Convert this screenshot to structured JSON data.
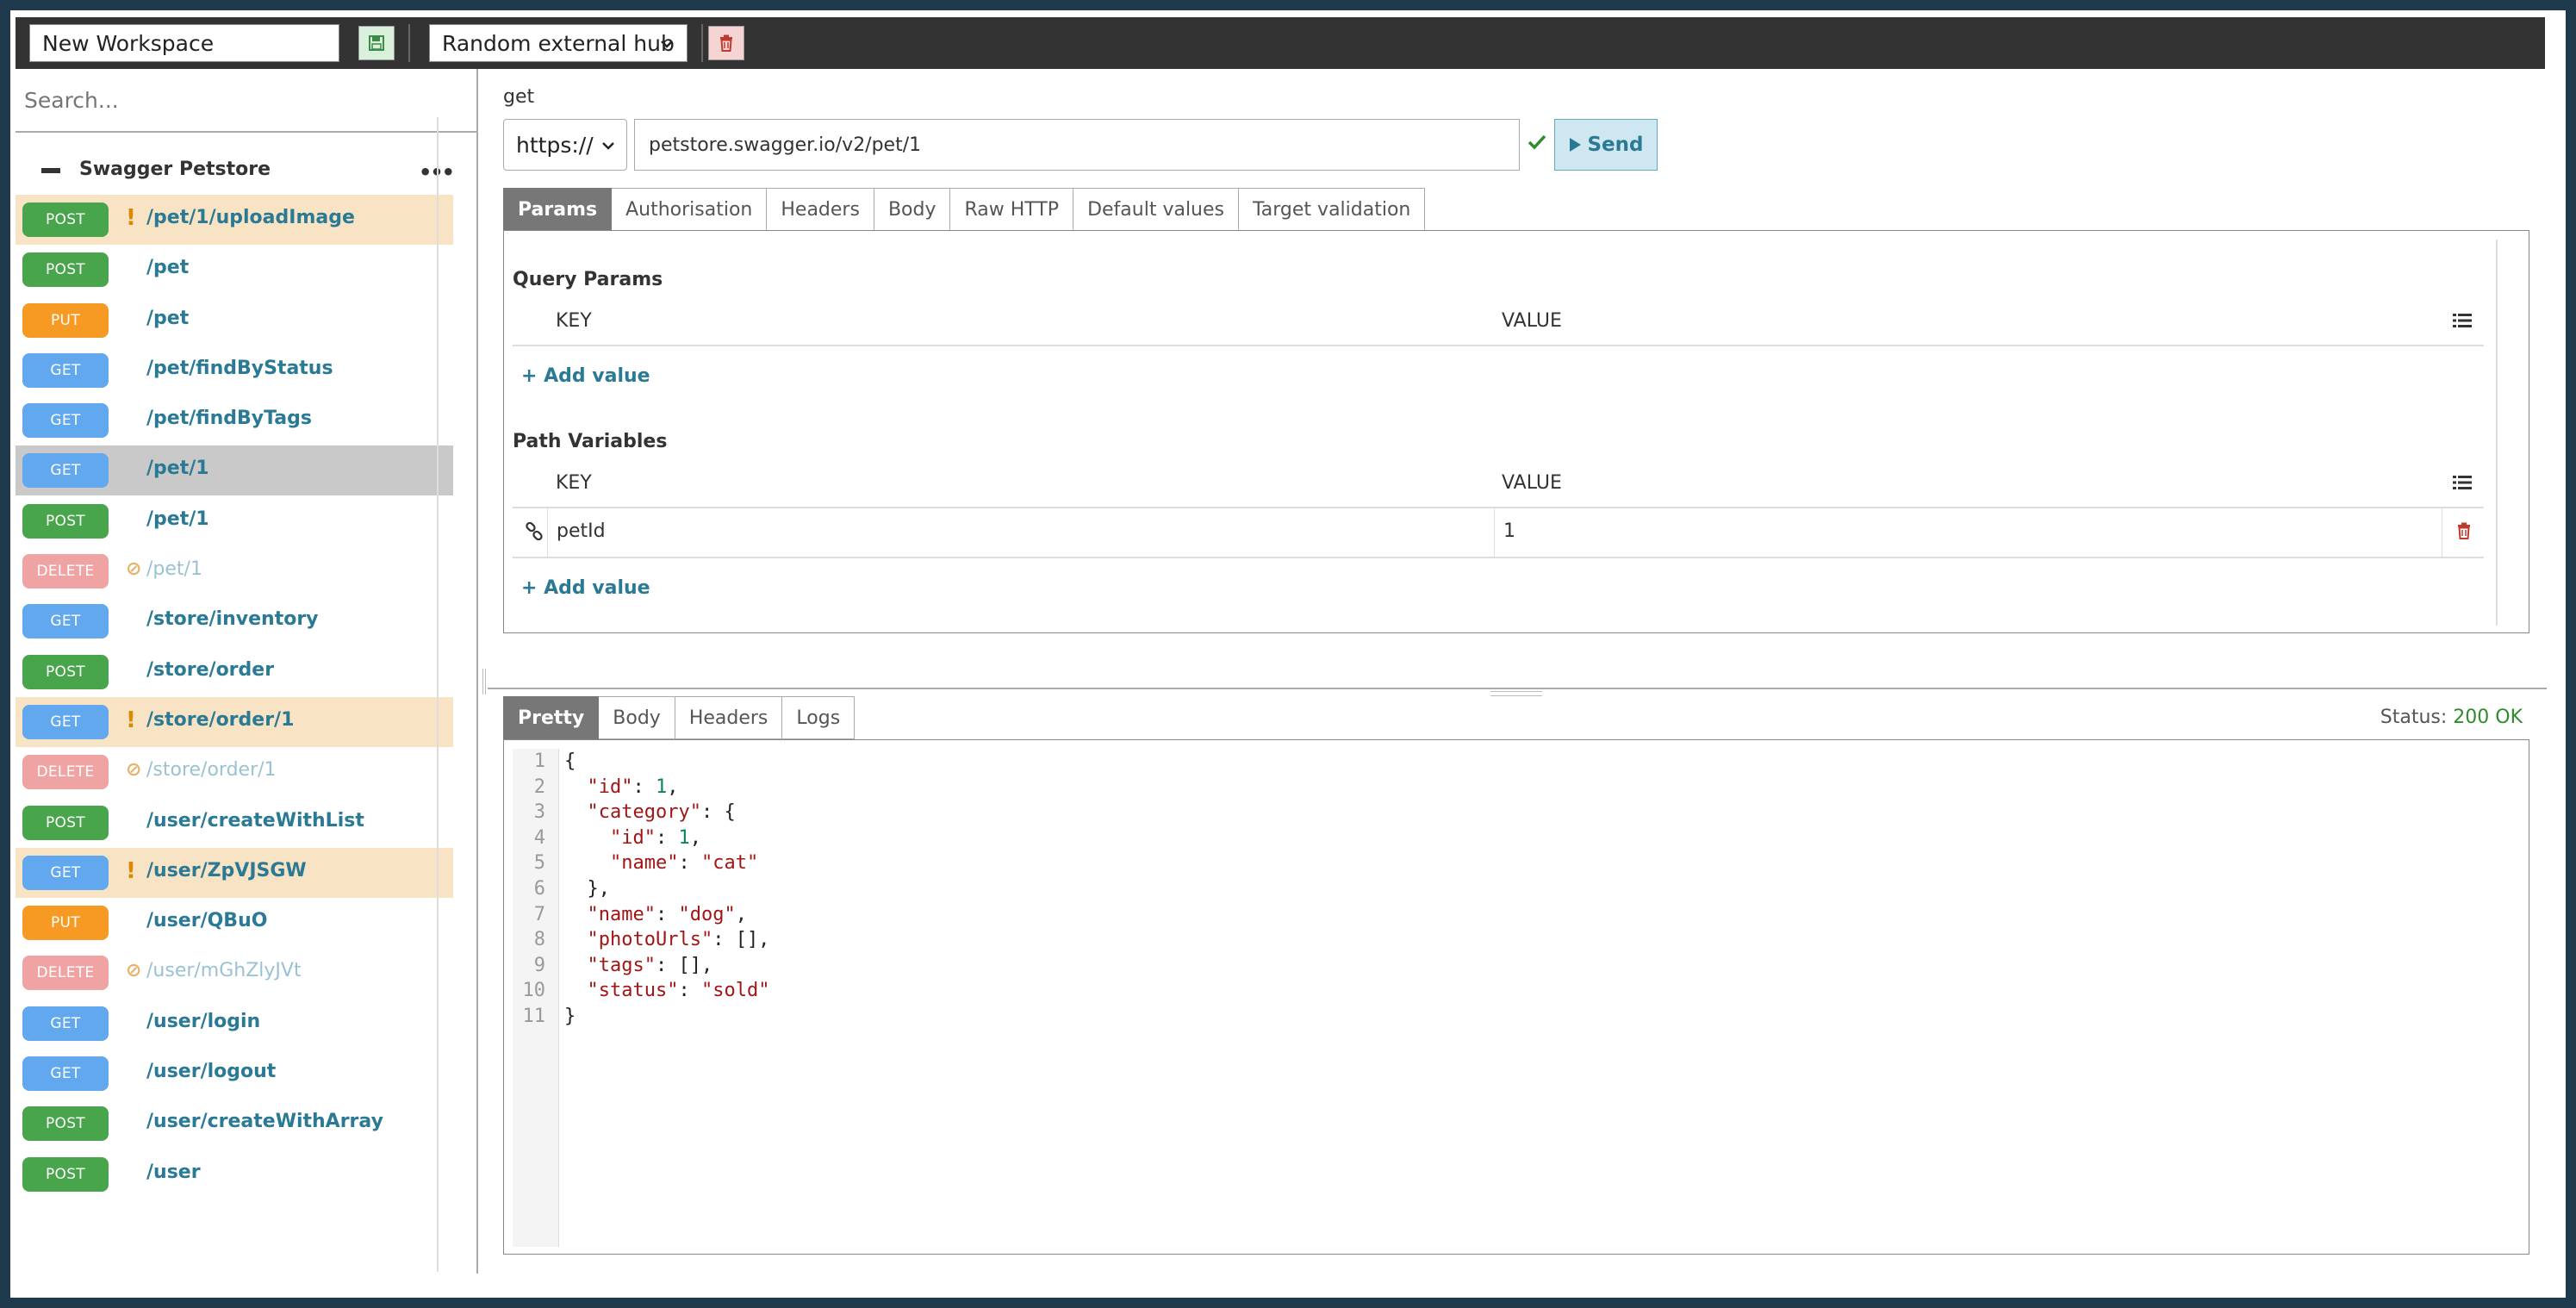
{
  "topbar": {
    "workspace_name": "New Workspace",
    "hub_selected": "Random external hub"
  },
  "sidebar": {
    "search_placeholder": "Search...",
    "collection_title": "Swagger Petstore",
    "endpoints": [
      {
        "method": "POST",
        "path": "/pet/1/uploadImage",
        "state": "warn"
      },
      {
        "method": "POST",
        "path": "/pet",
        "state": "normal"
      },
      {
        "method": "PUT",
        "path": "/pet",
        "state": "normal"
      },
      {
        "method": "GET",
        "path": "/pet/findByStatus",
        "state": "normal"
      },
      {
        "method": "GET",
        "path": "/pet/findByTags",
        "state": "normal"
      },
      {
        "method": "GET",
        "path": "/pet/1",
        "state": "selected"
      },
      {
        "method": "POST",
        "path": "/pet/1",
        "state": "normal"
      },
      {
        "method": "DELETE",
        "path": "/pet/1",
        "state": "deprecated"
      },
      {
        "method": "GET",
        "path": "/store/inventory",
        "state": "normal"
      },
      {
        "method": "POST",
        "path": "/store/order",
        "state": "normal"
      },
      {
        "method": "GET",
        "path": "/store/order/1",
        "state": "warn"
      },
      {
        "method": "DELETE",
        "path": "/store/order/1",
        "state": "deprecated"
      },
      {
        "method": "POST",
        "path": "/user/createWithList",
        "state": "normal"
      },
      {
        "method": "GET",
        "path": "/user/ZpVJSGW",
        "state": "warn"
      },
      {
        "method": "PUT",
        "path": "/user/QBuO",
        "state": "normal"
      },
      {
        "method": "DELETE",
        "path": "/user/mGhZlyJVt",
        "state": "deprecated"
      },
      {
        "method": "GET",
        "path": "/user/login",
        "state": "normal"
      },
      {
        "method": "GET",
        "path": "/user/logout",
        "state": "normal"
      },
      {
        "method": "POST",
        "path": "/user/createWithArray",
        "state": "normal"
      },
      {
        "method": "POST",
        "path": "/user",
        "state": "normal"
      }
    ]
  },
  "request": {
    "method_label": "get",
    "protocol": "https://",
    "url": "petstore.swagger.io/v2/pet/1",
    "send_label": "Send",
    "tabs": [
      "Params",
      "Authorisation",
      "Headers",
      "Body",
      "Raw HTTP",
      "Default values",
      "Target validation"
    ],
    "active_tab": "Params",
    "query_params_title": "Query Params",
    "path_variables_title": "Path Variables",
    "key_header": "KEY",
    "value_header": "VALUE",
    "add_value_label": "Add value",
    "path_variables": [
      {
        "key": "petId",
        "value": "1"
      }
    ]
  },
  "response": {
    "tabs": [
      "Pretty",
      "Body",
      "Headers",
      "Logs"
    ],
    "active_tab": "Pretty",
    "status_label": "Status:",
    "status_value": "200 OK",
    "body_lines": [
      "{",
      "  \"id\": 1,",
      "  \"category\": {",
      "    \"id\": 1,",
      "    \"name\": \"cat\"",
      "  },",
      "  \"name\": \"dog\",",
      "  \"photoUrls\": [],",
      "  \"tags\": [],",
      "  \"status\": \"sold\"",
      "}"
    ]
  },
  "colors": {
    "post": "#49a54c",
    "get": "#61a8ee",
    "put": "#f69a23",
    "delete": "#f0a3a3",
    "accent": "#2b7a95",
    "warn_row": "#f8e3c4",
    "selected_row": "#c9c9c9"
  },
  "icons": {
    "save": "floppy-disk-icon",
    "delete": "trash-icon",
    "valid": "check-icon",
    "send": "play-icon",
    "list": "list-icon",
    "link": "link-icon",
    "warn": "exclamation-icon",
    "deprecated": "ban-icon"
  }
}
